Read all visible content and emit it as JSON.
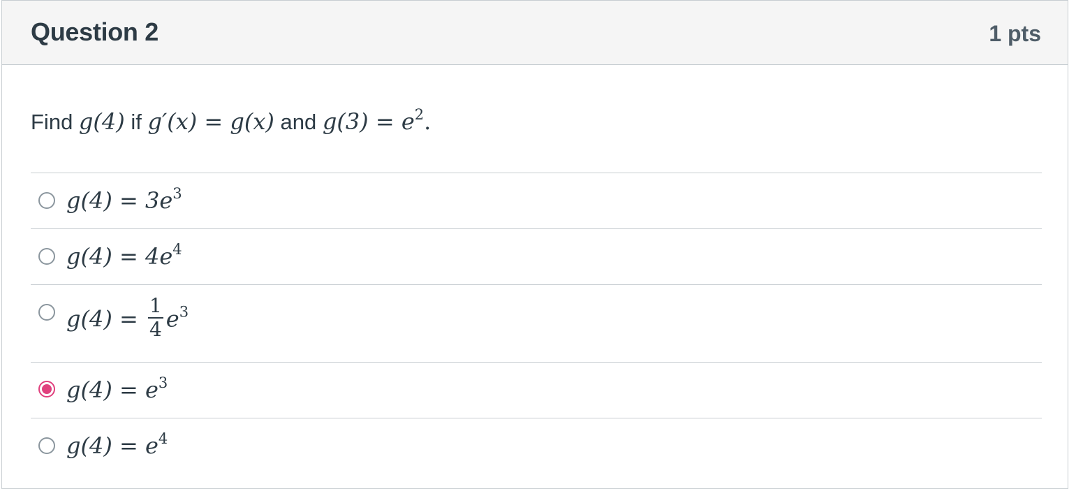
{
  "question": {
    "title": "Question 2",
    "points": "1 pts",
    "text": {
      "prefix": "Find ",
      "g4": "g(4)",
      "if": " if ",
      "gprime": "g′(x) = g(x)",
      "and": " and ",
      "condition_base": "g(3) = e",
      "condition_exp": "2",
      "end": "."
    }
  },
  "answers": [
    {
      "lhs": "g(4) = 3e",
      "exp": "3",
      "selected": false
    },
    {
      "lhs": "g(4) = 4e",
      "exp": "4",
      "selected": false
    },
    {
      "lhs": "g(4) = ",
      "frac_num": "1",
      "frac_den": "4",
      "after": "e",
      "exp": "3",
      "selected": false
    },
    {
      "lhs": "g(4) = e",
      "exp": "3",
      "selected": true
    },
    {
      "lhs": "g(4) = e",
      "exp": "4",
      "selected": false
    }
  ],
  "colors": {
    "accent": "#e0417e",
    "text": "#2d3b45",
    "header_bg": "#f5f5f5",
    "border": "#c7cdd1"
  }
}
